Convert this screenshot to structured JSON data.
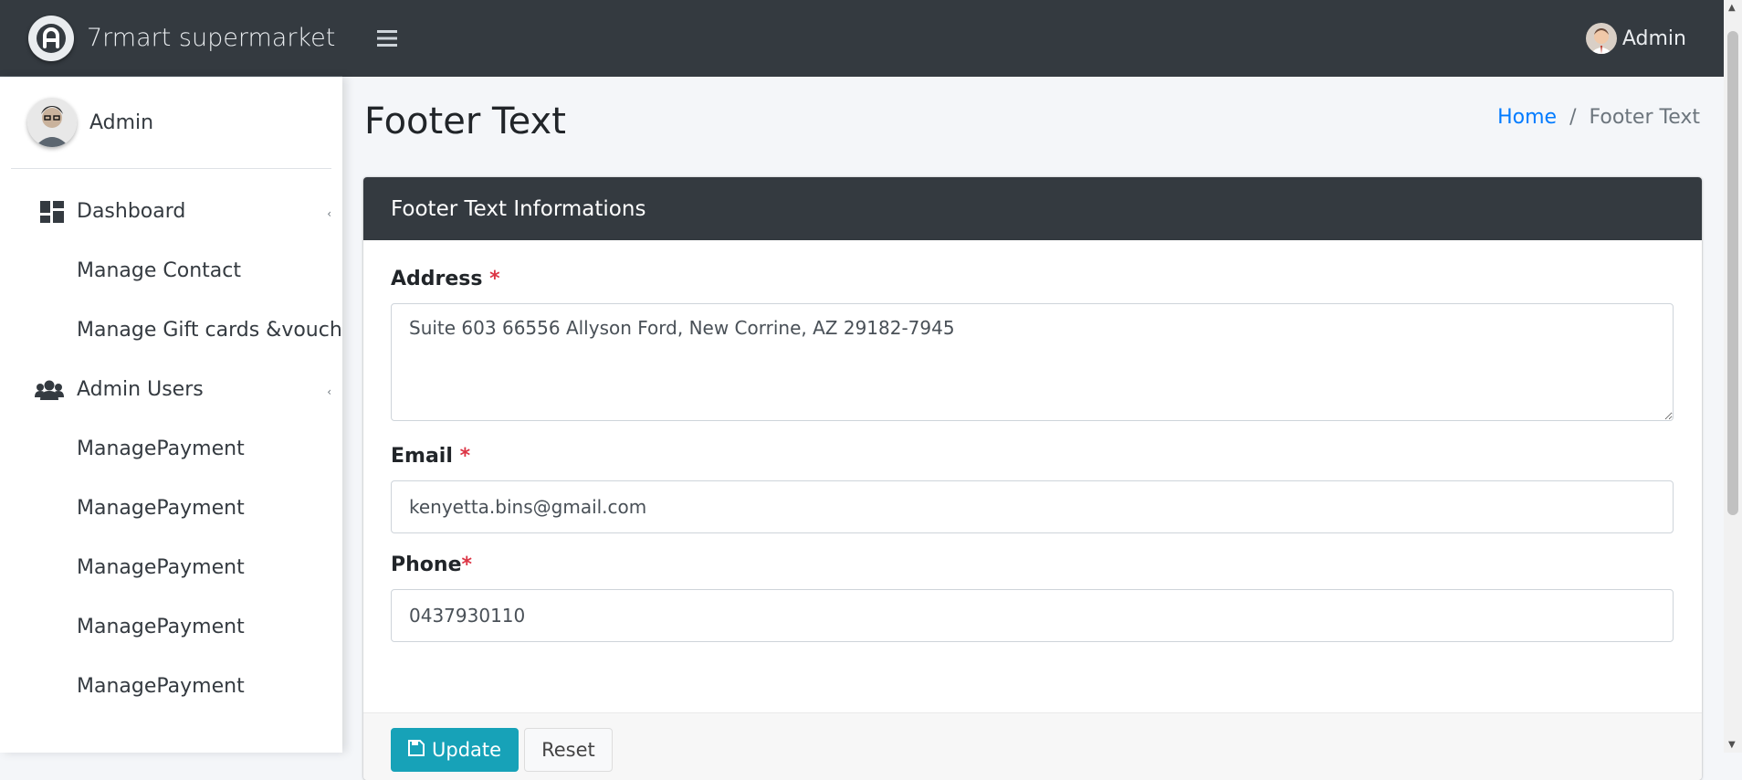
{
  "brand": {
    "name": "7rmart supermarket",
    "logo_icon": "app-logo-icon"
  },
  "topbar": {
    "user_name": "Admin"
  },
  "sidebar": {
    "user_name": "Admin",
    "items": [
      {
        "label": "Dashboard",
        "icon": "dashboard-icon",
        "type": "parent"
      },
      {
        "label": "Manage Contact",
        "type": "sub"
      },
      {
        "label": "Manage Gift cards &voucher",
        "type": "sub"
      },
      {
        "label": "Admin Users",
        "icon": "users-icon",
        "type": "parent"
      },
      {
        "label": "ManagePayment",
        "type": "sub"
      },
      {
        "label": "ManagePayment",
        "type": "sub"
      },
      {
        "label": "ManagePayment",
        "type": "sub"
      },
      {
        "label": "ManagePayment",
        "type": "sub"
      },
      {
        "label": "ManagePayment",
        "type": "sub"
      }
    ]
  },
  "page": {
    "title": "Footer Text",
    "breadcrumb": {
      "home": "Home",
      "separator": "/",
      "current": "Footer Text"
    }
  },
  "card": {
    "title": "Footer Text Informations",
    "fields": {
      "address": {
        "label": "Address",
        "required_mark": "*",
        "value": "Suite 603 66556 Allyson Ford, New Corrine, AZ 29182-7945"
      },
      "email": {
        "label": "Email",
        "required_mark": "*",
        "value": "kenyetta.bins@gmail.com"
      },
      "phone": {
        "label": "Phone",
        "required_mark": "*",
        "value": "0437930110"
      }
    },
    "buttons": {
      "update": "Update",
      "reset": "Reset"
    }
  },
  "colors": {
    "topbar": "#343a40",
    "accent": "#17a2b8",
    "link": "#007bff",
    "required": "#dc3545"
  }
}
